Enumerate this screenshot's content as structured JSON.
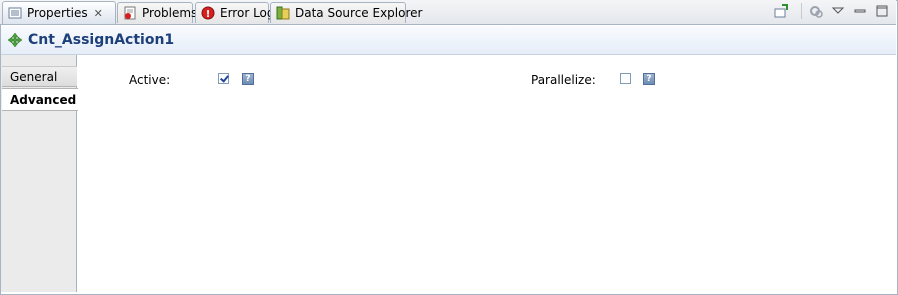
{
  "tabs": [
    {
      "label": "Properties",
      "icon": "properties-icon",
      "active": true,
      "closable": true
    },
    {
      "label": "Problems",
      "icon": "problems-icon",
      "active": false
    },
    {
      "label": "Error Log",
      "icon": "error-log-icon",
      "active": false
    },
    {
      "label": "Data Source Explorer",
      "icon": "data-source-explorer-icon",
      "active": false
    }
  ],
  "toolbar": {
    "icons": [
      "pin-icon",
      "view-menu-icon",
      "dropdown-icon",
      "minimize-icon",
      "maximize-icon"
    ]
  },
  "header": {
    "title": "Cnt_AssignAction1",
    "icon": "assign-action-icon"
  },
  "nav": {
    "items": [
      {
        "label": "General",
        "selected": false
      },
      {
        "label": "Advanced",
        "selected": true
      }
    ]
  },
  "form": {
    "active": {
      "label": "Active:",
      "checked": true
    },
    "parallelize": {
      "label": "Parallelize:",
      "checked": false
    }
  },
  "colors": {
    "title": "#1d3f7a",
    "border": "#a9b4c2",
    "help": "#6f8db5"
  }
}
